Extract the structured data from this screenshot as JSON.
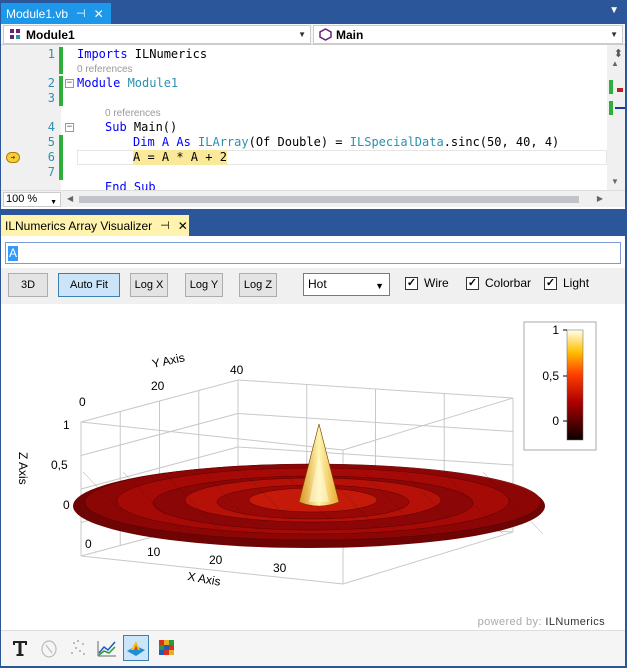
{
  "editor": {
    "tab_title": "Module1.vb",
    "tab_pin": "⊣",
    "tab_close": "✕",
    "nav_left": "Module1",
    "nav_right": "Main",
    "zoom": "100 %",
    "lines": [
      {
        "num": "1",
        "text": [
          "Imports ",
          "ILNumerics"
        ]
      },
      {
        "refs": "0 references"
      },
      {
        "num": "2",
        "text": [
          "Module ",
          "Module1"
        ]
      },
      {
        "num": "3",
        "text": [
          ""
        ]
      },
      {
        "refs": "0 references"
      },
      {
        "num": "4",
        "text": [
          "Sub ",
          "Main()"
        ]
      },
      {
        "num": "5",
        "text": [
          "Dim A As ",
          "ILArray",
          "(Of Double) = ",
          "ILSpecialData",
          ".sinc(50, 40, 4)"
        ]
      },
      {
        "num": "6",
        "text": [
          "A = A * A + 2"
        ]
      },
      {
        "num": "7",
        "text": [
          ""
        ]
      },
      {
        "num": "",
        "text": [
          "End Sub"
        ]
      }
    ]
  },
  "visualizer": {
    "tab_title": "ILNumerics Array Visualizer",
    "tab_pin": "⊣",
    "tab_close": "✕",
    "expression": "A",
    "buttons": {
      "b3d": "3D",
      "autofit": "Auto Fit",
      "logx": "Log X",
      "logy": "Log Y",
      "logz": "Log Z"
    },
    "colormap": "Hot",
    "checkboxes": {
      "wire": "Wire",
      "colorbar": "Colorbar",
      "light": "Light"
    },
    "powered_by": "powered by:",
    "brand": "ILNumerics"
  },
  "chart_data": {
    "type": "surface3d",
    "title": "",
    "xlabel": "X Axis",
    "ylabel": "Y Axis",
    "zlabel": "Z Axis",
    "x_ticks": [
      "0",
      "10",
      "20",
      "30"
    ],
    "y_ticks": [
      "0",
      "20",
      "40"
    ],
    "z_ticks": [
      "0",
      "0,5",
      "1"
    ],
    "colorbar_ticks": [
      "1",
      "0,5",
      "0"
    ],
    "colormap": "hot",
    "function": "sinc(50, 40, 4)",
    "xlim": [
      0,
      40
    ],
    "ylim": [
      0,
      50
    ],
    "zlim": [
      0,
      1
    ]
  },
  "colors": {
    "vs_blue": "#2b579a",
    "tab_active": "#1c97ea",
    "tool_tab": "#fff3ad",
    "change_bar": "#2eaf3c",
    "highlight": "#fbe99a"
  },
  "icons": [
    "text-icon",
    "cursor-icon",
    "scatter-icon",
    "line-plot-icon",
    "surface-icon",
    "imagesc-icon"
  ]
}
